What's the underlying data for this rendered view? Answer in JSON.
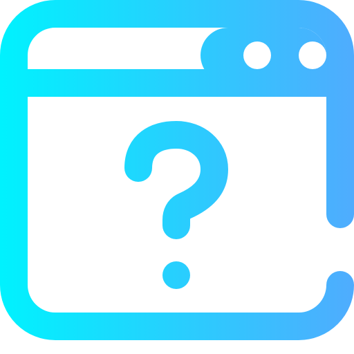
{
  "icon": {
    "name": "browser-window-question-icon",
    "gradient_start": "#00F2FE",
    "gradient_end": "#4FACFE"
  }
}
